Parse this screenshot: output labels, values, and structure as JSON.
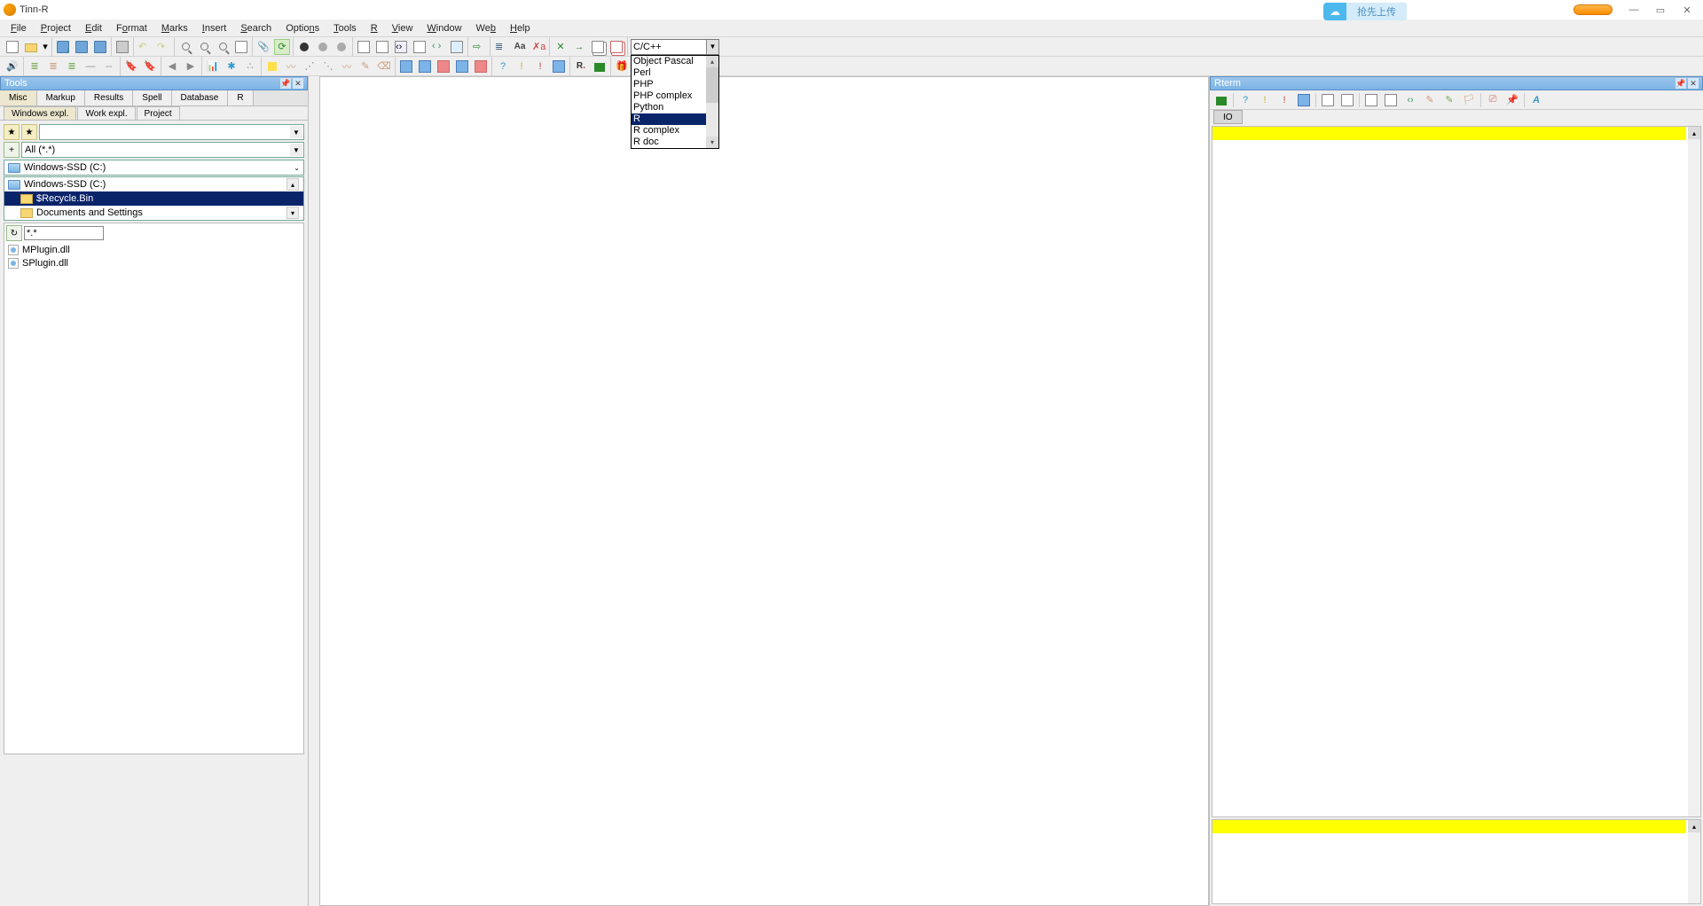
{
  "window": {
    "title": "Tinn-R",
    "cloud_text": "抢先上传"
  },
  "menus": [
    "File",
    "Project",
    "Edit",
    "Format",
    "Marks",
    "Insert",
    "Search",
    "Options",
    "Tools",
    "R",
    "View",
    "Window",
    "Web",
    "Help"
  ],
  "syntax_combo": {
    "selected": "C/C++",
    "options": [
      "Object Pascal",
      "Perl",
      "PHP",
      "PHP complex",
      "Python",
      "R",
      "R complex",
      "R doc"
    ],
    "highlighted": "R"
  },
  "tools_panel": {
    "title": "Tools",
    "tabs": [
      "Misc",
      "Markup",
      "Results",
      "Spell",
      "Database",
      "R"
    ],
    "active_tab": "Misc",
    "sub_tabs": [
      "Windows expl.",
      "Work expl.",
      "Project"
    ],
    "active_sub": "Windows expl.",
    "filter_text": "All (*.*)",
    "drive1": "Windows-SSD (C:)",
    "drive2": "Windows-SSD (C:)",
    "folder_sel": "$Recycle.Bin",
    "folder2": "Documents and Settings",
    "file_filter": "*.*",
    "files": [
      "MPlugin.dll",
      "SPlugin.dll"
    ]
  },
  "rterm": {
    "title": "Rterm",
    "tab": "IO"
  }
}
